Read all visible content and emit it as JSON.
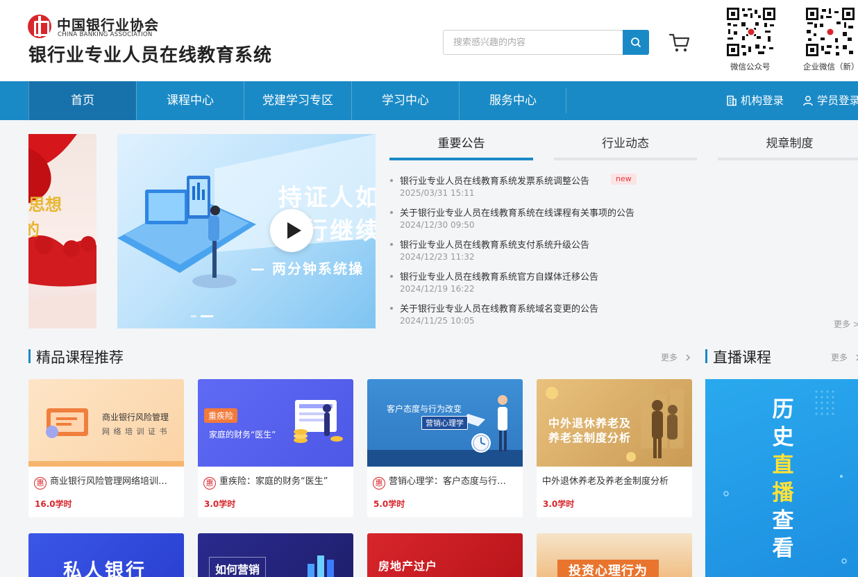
{
  "header": {
    "logo_cn": "中国银行业协会",
    "logo_en": "CHINA BANKING ASSOCIATION",
    "site_title": "银行业专业人员在线教育系统",
    "search_placeholder": "搜索感兴趣的内容",
    "qr_codes": [
      {
        "caption": "微信公众号"
      },
      {
        "caption": "企业微信（新）"
      }
    ]
  },
  "nav": {
    "items": [
      {
        "label": "首页",
        "active": true
      },
      {
        "label": "课程中心"
      },
      {
        "label": "党建学习专区"
      },
      {
        "label": "学习中心"
      },
      {
        "label": "服务中心"
      }
    ],
    "org_login": "机构登录",
    "student_login": "学员登录"
  },
  "banner": {
    "side_text": [
      "思想",
      "的"
    ],
    "main_line1": "持证人如",
    "main_line2": "进行继续",
    "main_line3": "—  两分钟系统操"
  },
  "notices": {
    "tabs": [
      "重要公告",
      "行业动态",
      "规章制度"
    ],
    "items": [
      {
        "title": "银行业专业人员在线教育系统发票系统调整公告",
        "date": "2025/03/31 15:11",
        "badge": "new"
      },
      {
        "title": "关于银行业专业人员在线教育系统在线课程有关事项的公告",
        "date": "2024/12/30 09:50"
      },
      {
        "title": "银行业专业人员在线教育系统支付系统升级公告",
        "date": "2024/12/23 11:32"
      },
      {
        "title": "银行业专业人员在线教育系统官方自媒体迁移公告",
        "date": "2024/12/19 16:22"
      },
      {
        "title": "关于银行业专业人员在线教育系统域名变更的公告",
        "date": "2024/11/25 10:05"
      }
    ],
    "more": "更多 >"
  },
  "courses": {
    "title": "精品课程推荐",
    "more": "更多",
    "hui": "惠",
    "items": [
      {
        "name": "商业银行风险管理网络培训…",
        "hours": "16.0学时",
        "thumb_line1": "商业银行风险管理",
        "thumb_line2": "网 络 培 训 证 书"
      },
      {
        "name": "重疾险：家庭的财务“医生”",
        "hours": "3.0学时",
        "thumb_tag": "重疾险",
        "thumb_line1": "家庭的财务“医生”"
      },
      {
        "name": "营销心理学：客户态度与行…",
        "hours": "5.0学时",
        "thumb_line1": "客户态度与行为改变",
        "thumb_tag": "营销心理学"
      },
      {
        "name": "中外退休养老及养老金制度分析",
        "hours": "3.0学时",
        "thumb_line1": "中外退休养老及",
        "thumb_line2": "养老金制度分析"
      }
    ],
    "row2": [
      "私人银行",
      "如何营销",
      "房地产过户",
      "投资心理行为"
    ]
  },
  "live": {
    "title": "直播课程",
    "more": "更多",
    "chars": [
      "历",
      "史",
      "直",
      "播",
      "查",
      "看"
    ]
  },
  "colors": {
    "brand_blue": "#1a8ac6",
    "nav_active": "#1772ac",
    "accent_red": "#d7262c"
  }
}
